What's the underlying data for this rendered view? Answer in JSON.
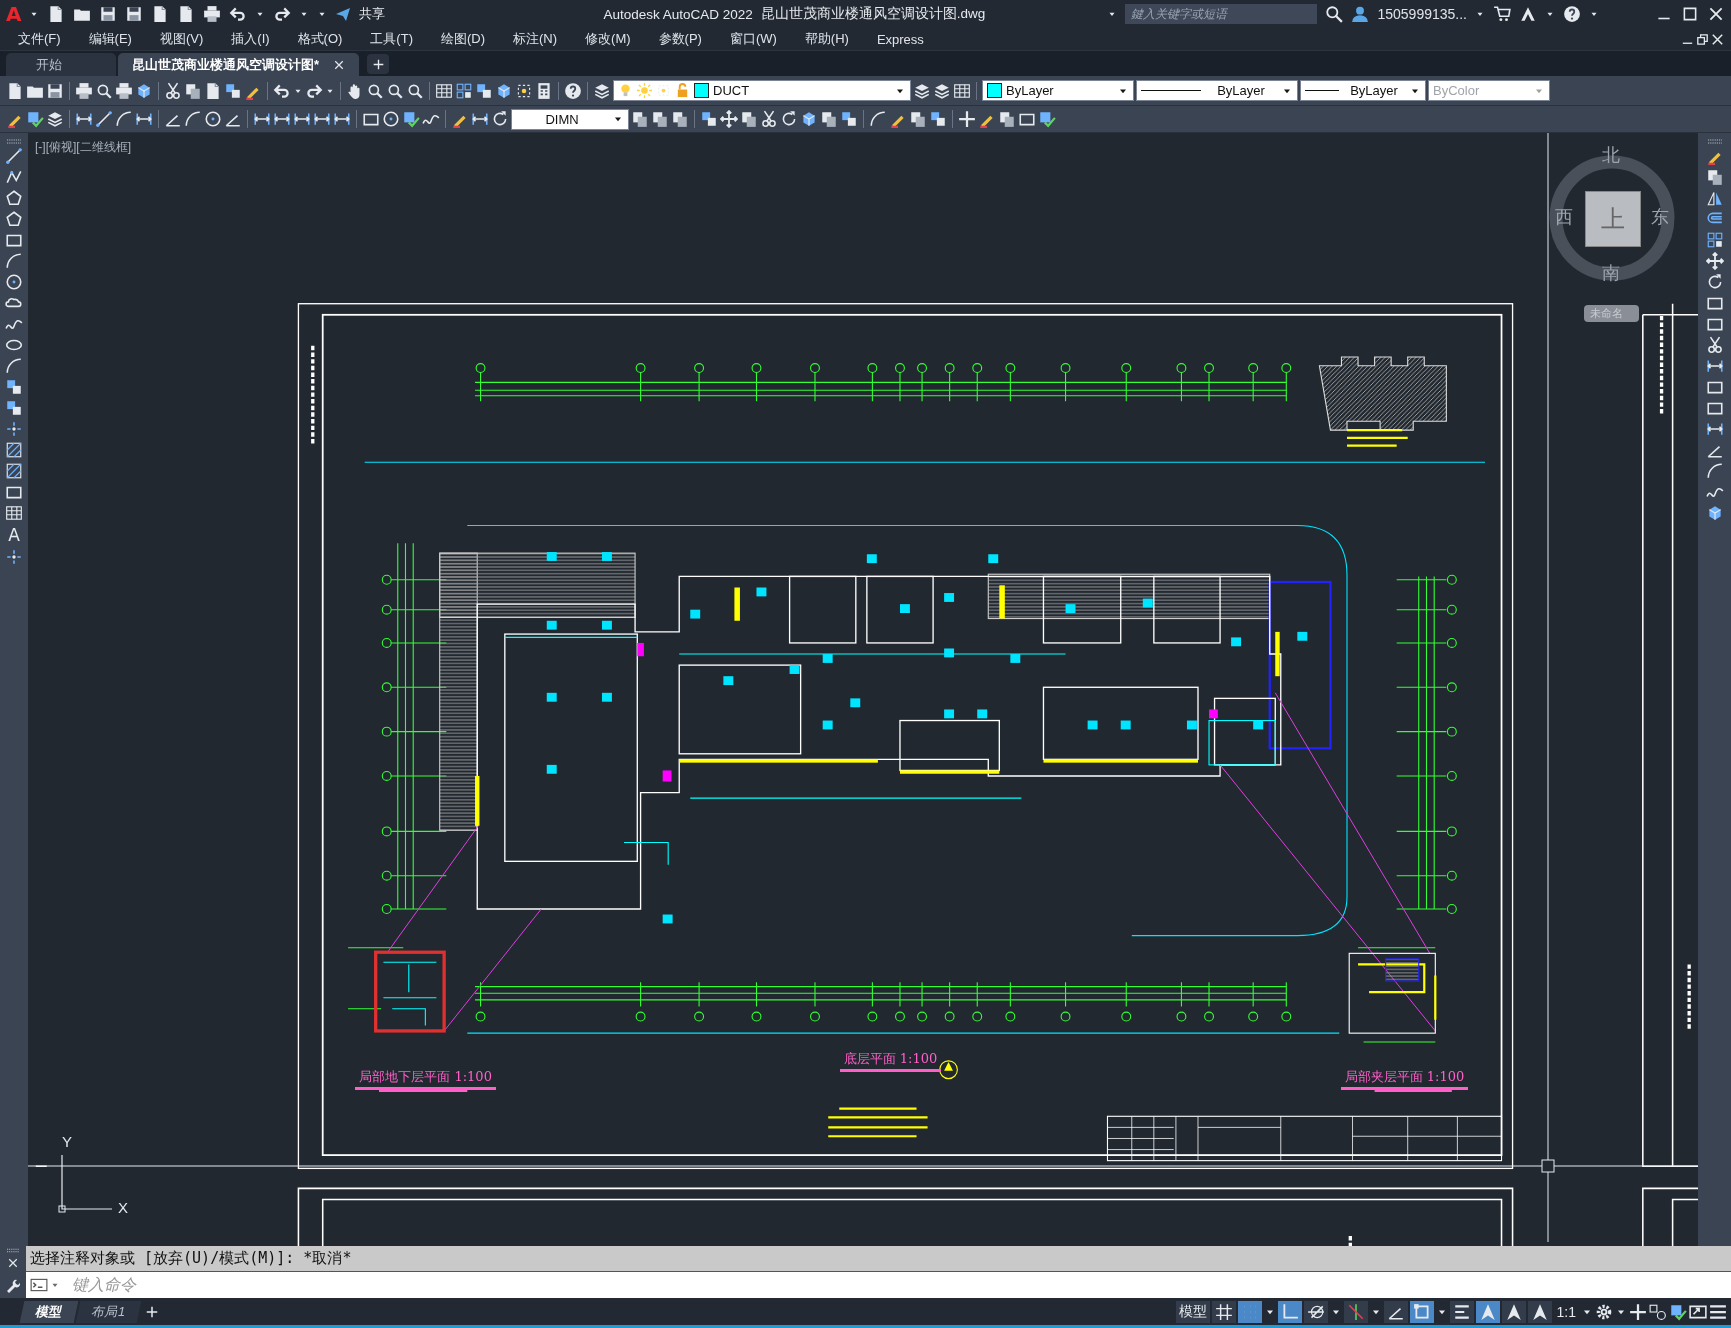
{
  "title_bar": {
    "logo": "A",
    "share": "共享",
    "title": "Autodesk AutoCAD 2022",
    "file_name": "昆山世茂商业楼通风空调设计图.dwg",
    "search": {
      "placeholder": "鍵入关键字或短语"
    },
    "user": "1505999135..."
  },
  "menu": [
    "文件(F)",
    "编辑(E)",
    "视图(V)",
    "插入(I)",
    "格式(O)",
    "工具(T)",
    "绘图(D)",
    "标注(N)",
    "修改(M)",
    "参数(P)",
    "窗口(W)",
    "帮助(H)",
    "Express"
  ],
  "file_tabs": [
    {
      "label": "开始",
      "selected": false
    },
    {
      "label": "昆山世茂商业楼通风空调设计图*",
      "selected": true
    }
  ],
  "properties_toolbar": {
    "layer": {
      "value": "DUCT",
      "color": "#00ffff"
    },
    "color": {
      "value": "ByLayer",
      "color": "#00ffff"
    },
    "linetype": {
      "value": "ByLayer"
    },
    "lineweight": {
      "value": "ByLayer"
    },
    "plot_style": {
      "value": "ByColor",
      "disabled": true
    }
  },
  "dimension_toolbar": {
    "dim_style": {
      "value": "DIMN"
    }
  },
  "draw_toolbar": {
    "text_tool_glyph": "A"
  },
  "viewport": {
    "label": "[-][俯视][二维线框]",
    "viewcube": {
      "north": "北",
      "south": "南",
      "east": "东",
      "west": "西",
      "face": "上",
      "ucs_menu": "未命名"
    },
    "ucs": {
      "x": "X",
      "y": "Y"
    },
    "plan_titles": [
      {
        "text": "局部地下层平面 1:100"
      },
      {
        "text": "底层平面 1:100"
      },
      {
        "text": "局部夹层平面 1:100"
      }
    ]
  },
  "command_line": {
    "history": "选择注释对象或 [放弃(U)/模式(M)]: *取消*",
    "placeholder": "键入命令"
  },
  "layout_tabs": [
    {
      "label": "模型",
      "selected": true
    },
    {
      "label": "布局1",
      "selected": false
    }
  ],
  "status_bar": {
    "space": "模型",
    "toggles": [
      {
        "on": false
      },
      {
        "on": true
      },
      {
        "on": true
      },
      {
        "on": false
      },
      {
        "on": false
      },
      {
        "on": false
      },
      {
        "on": true
      },
      {
        "on": false
      },
      {
        "on": true
      },
      {
        "on": false
      },
      {
        "on": false
      }
    ],
    "scale": "1:1"
  }
}
